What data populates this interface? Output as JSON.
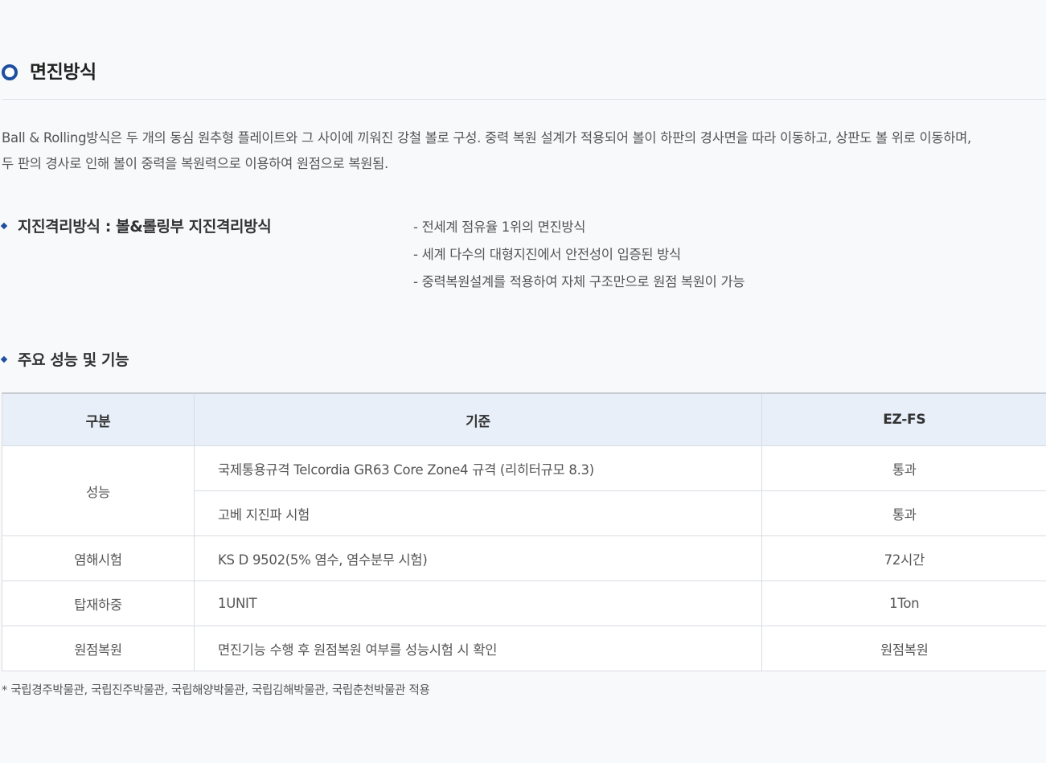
{
  "section": {
    "title": "면진방식"
  },
  "description": {
    "line1": "Ball & Rolling방식은 두 개의 동심 원추형 플레이트와 그 사이에 끼워진 강철 볼로 구성. 중력 복원 설계가 적용되어 볼이 하판의 경사면을 따라 이동하고, 상판도 볼 위로 이동하며,",
    "line2": "두 판의 경사로 인해 볼이 중력을 복원력으로 이용하여 원점으로 복원됨."
  },
  "isolation": {
    "title": "지진격리방식 : 볼&롤링부 지진격리방식",
    "bullets": [
      "- 전세계 점유율 1위의 면진방식",
      "- 세계 다수의 대형지진에서 안전성이 입증된 방식",
      "- 중력복원설계를 적용하여 자체 구조만으로 원점 복원이 가능"
    ]
  },
  "performance": {
    "title": "주요 성능 및 기능",
    "headers": [
      "구분",
      "기준",
      "EZ-FS"
    ],
    "rows": [
      {
        "category": "성능",
        "standard": "국제통용규격 Telcordia GR63 Core Zone4 규격 (리히터규모 8.3)",
        "result": "통과"
      },
      {
        "category": "",
        "standard": "고베 지진파 시험",
        "result": "통과"
      },
      {
        "category": "염해시험",
        "standard": "KS D 9502(5% 염수, 염수분무 시험)",
        "result": "72시간"
      },
      {
        "category": "탑재하중",
        "standard": "1UNIT",
        "result": "1Ton"
      },
      {
        "category": "원점복원",
        "standard": "면진기능 수행 후 원점복원 여부를 성능시험 시 확인",
        "result": "원점복원"
      }
    ]
  },
  "note": "* 국립경주박물관, 국립진주박물관, 국립해양박물관, 국립김해박물관, 국립춘천박물관 적용",
  "colors": {
    "accent": "#1e4fa0",
    "header_bg": "#e8eff9",
    "page_bg": "#f8f9fb"
  }
}
